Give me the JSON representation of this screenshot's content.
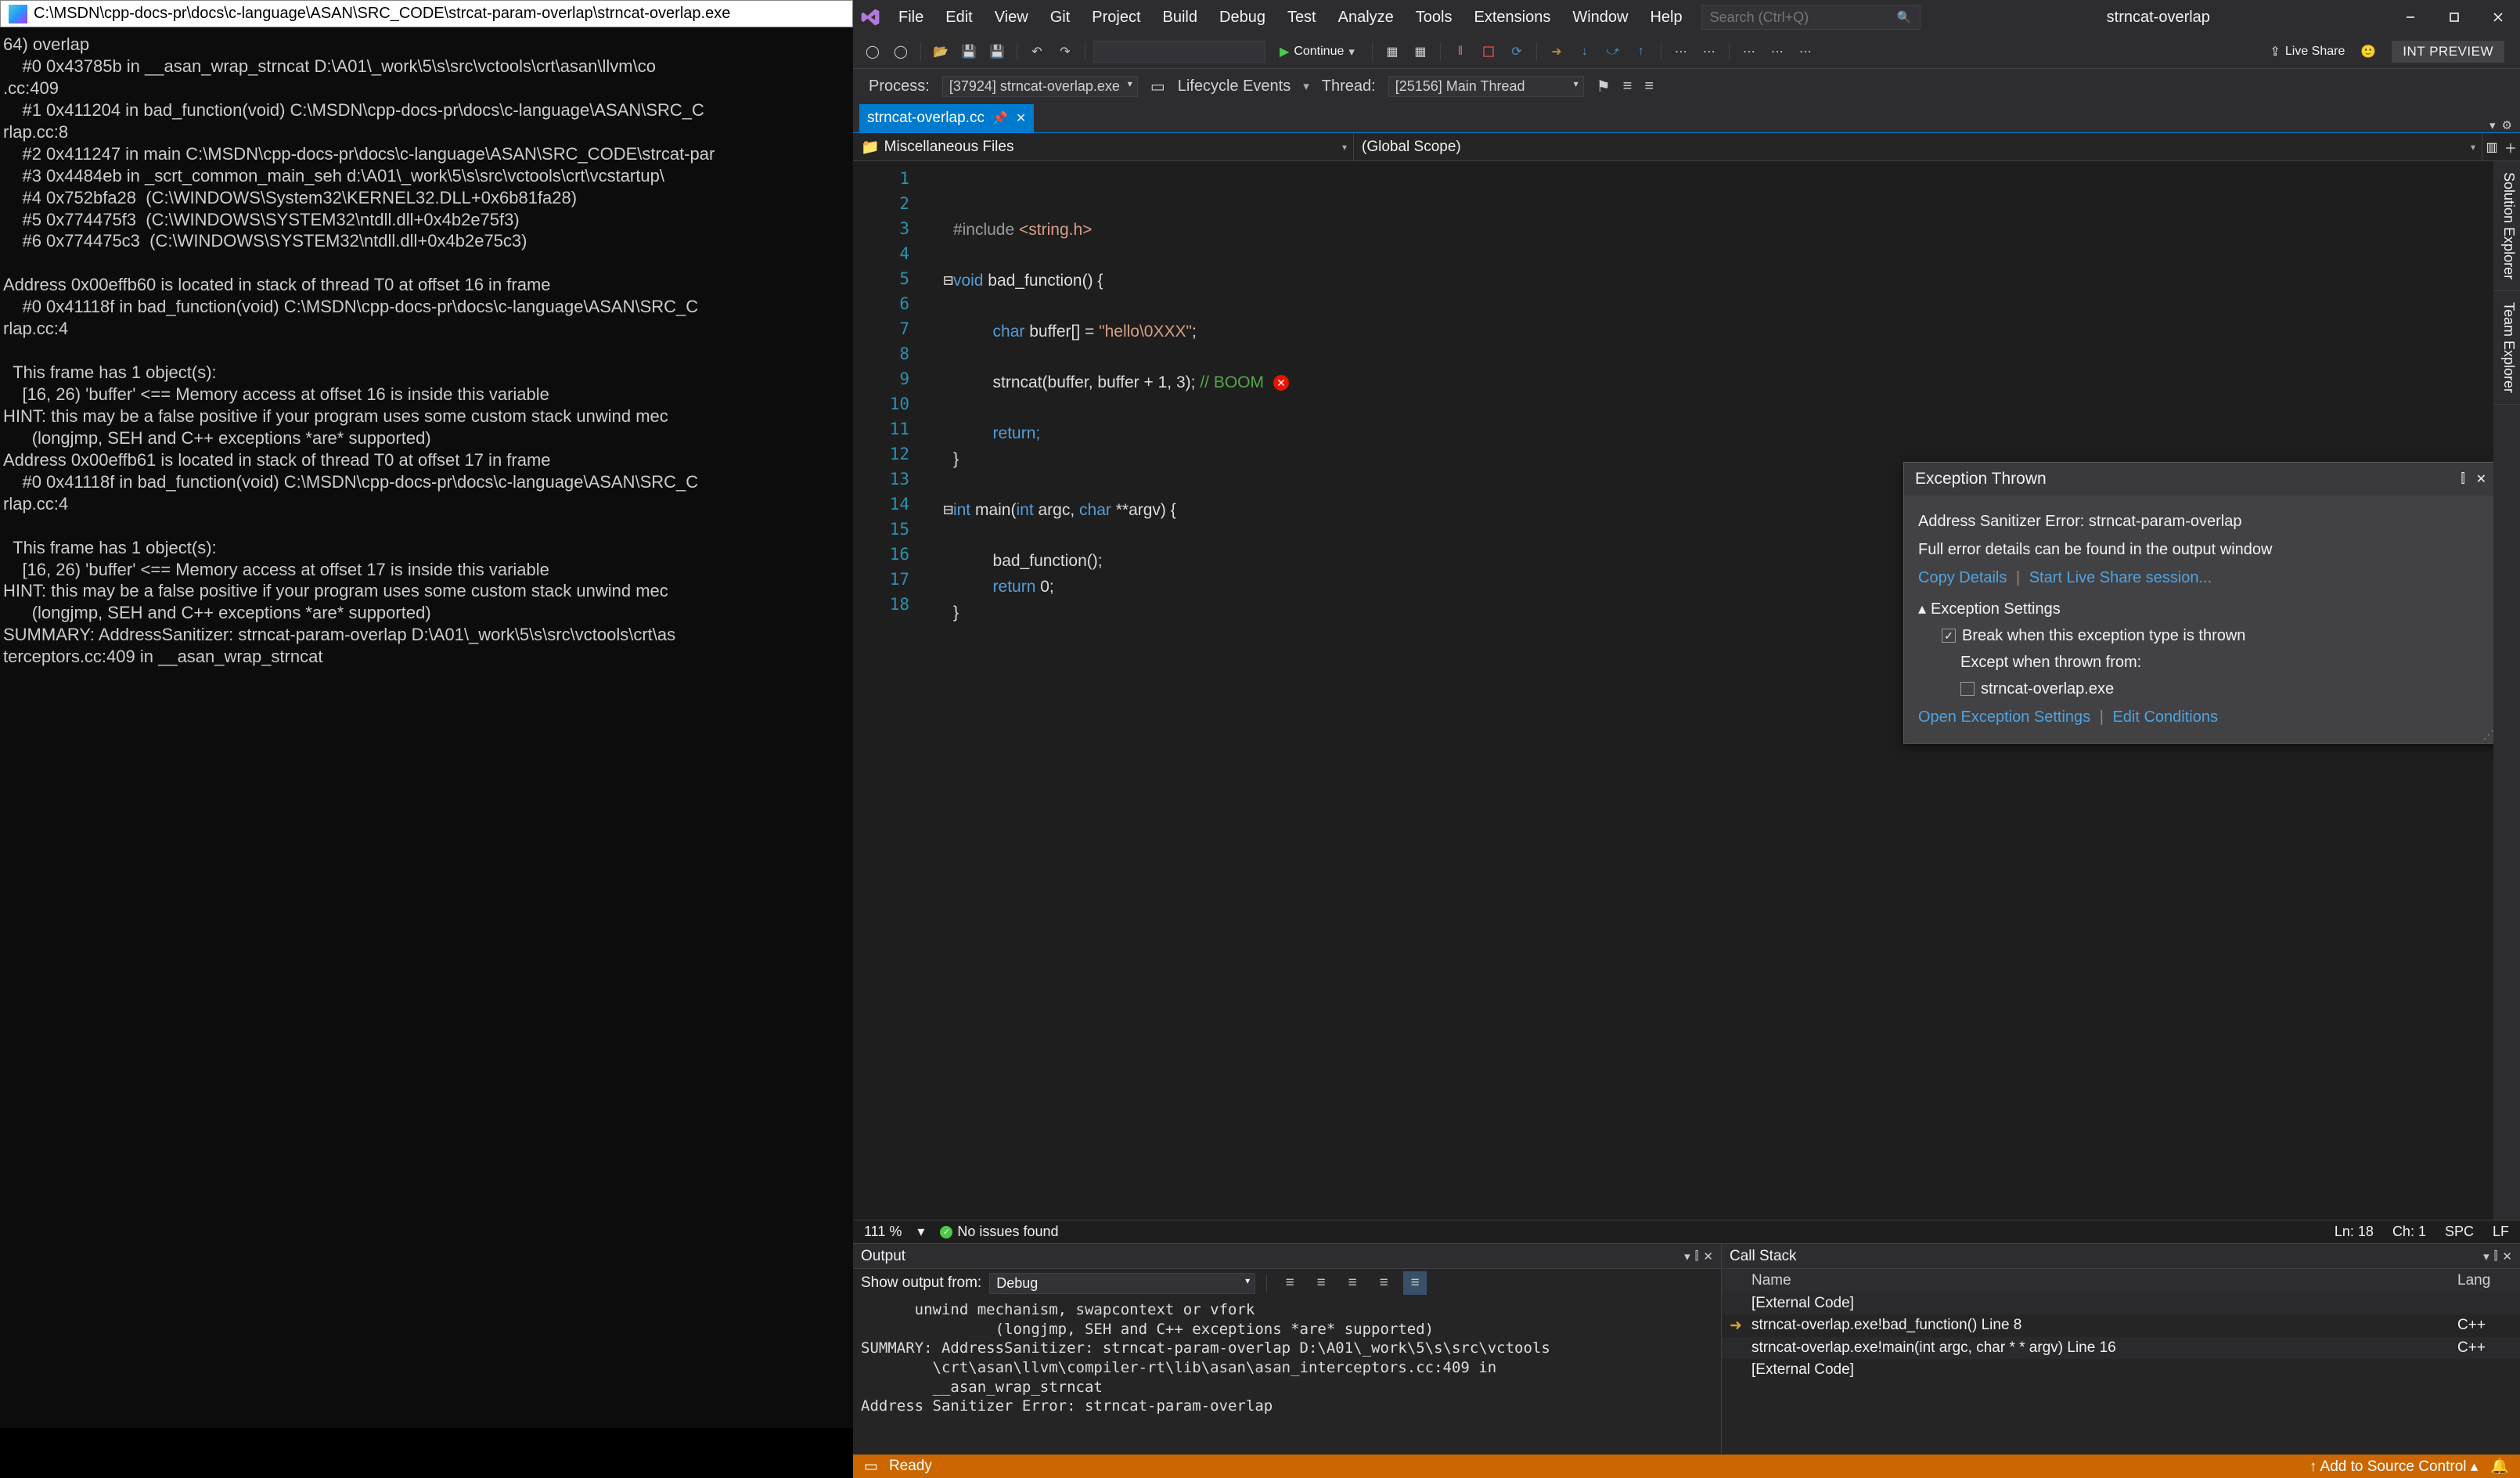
{
  "console": {
    "title": "C:\\MSDN\\cpp-docs-pr\\docs\\c-language\\ASAN\\SRC_CODE\\strcat-param-overlap\\strncat-overlap.exe",
    "body": "64) overlap\n    #0 0x43785b in __asan_wrap_strncat D:\\A01\\_work\\5\\s\\src\\vctools\\crt\\asan\\llvm\\co\n.cc:409\n    #1 0x411204 in bad_function(void) C:\\MSDN\\cpp-docs-pr\\docs\\c-language\\ASAN\\SRC_C\nrlap.cc:8\n    #2 0x411247 in main C:\\MSDN\\cpp-docs-pr\\docs\\c-language\\ASAN\\SRC_CODE\\strcat-par\n    #3 0x4484eb in _scrt_common_main_seh d:\\A01\\_work\\5\\s\\src\\vctools\\crt\\vcstartup\\\n    #4 0x752bfa28  (C:\\WINDOWS\\System32\\KERNEL32.DLL+0x6b81fa28)\n    #5 0x774475f3  (C:\\WINDOWS\\SYSTEM32\\ntdll.dll+0x4b2e75f3)\n    #6 0x774475c3  (C:\\WINDOWS\\SYSTEM32\\ntdll.dll+0x4b2e75c3)\n\nAddress 0x00effb60 is located in stack of thread T0 at offset 16 in frame\n    #0 0x41118f in bad_function(void) C:\\MSDN\\cpp-docs-pr\\docs\\c-language\\ASAN\\SRC_C\nrlap.cc:4\n\n  This frame has 1 object(s):\n    [16, 26) 'buffer' <== Memory access at offset 16 is inside this variable\nHINT: this may be a false positive if your program uses some custom stack unwind mec\n      (longjmp, SEH and C++ exceptions *are* supported)\nAddress 0x00effb61 is located in stack of thread T0 at offset 17 in frame\n    #0 0x41118f in bad_function(void) C:\\MSDN\\cpp-docs-pr\\docs\\c-language\\ASAN\\SRC_C\nrlap.cc:4\n\n  This frame has 1 object(s):\n    [16, 26) 'buffer' <== Memory access at offset 17 is inside this variable\nHINT: this may be a false positive if your program uses some custom stack unwind mec\n      (longjmp, SEH and C++ exceptions *are* supported)\nSUMMARY: AddressSanitizer: strncat-param-overlap D:\\A01\\_work\\5\\s\\src\\vctools\\crt\\as\nterceptors.cc:409 in __asan_wrap_strncat"
  },
  "menus": [
    "File",
    "Edit",
    "View",
    "Git",
    "Project",
    "Build",
    "Debug",
    "Test",
    "Analyze",
    "Tools",
    "Extensions",
    "Window",
    "Help"
  ],
  "search_placeholder": "Search (Ctrl+Q)",
  "solution_name": "strncat-overlap",
  "continue_label": "Continue",
  "live_share": "Live Share",
  "int_preview": "INT PREVIEW",
  "process_label": "Process:",
  "process_value": "[37924] strncat-overlap.exe",
  "lifecycle_label": "Lifecycle Events",
  "thread_label": "Thread:",
  "thread_value": "[25156] Main Thread",
  "tab_name": "strncat-overlap.cc",
  "nav1": "Miscellaneous Files",
  "nav2": "(Global Scope)",
  "code_lines": {
    "l1": "",
    "l2_a": "#include",
    "l2_b": " <string.h>",
    "l4_a": "void",
    "l4_b": " bad_function() {",
    "l6_a": "char",
    "l6_b": " buffer[] = ",
    "l6_c": "\"hello\\0XXX\"",
    "l6_d": ";",
    "l8_a": "strncat(buffer, buffer + 1, 3); ",
    "l8_b": "// BOOM",
    "l10": "return;",
    "l11": "}",
    "l13_a": "int",
    "l13_b": " main(",
    "l13_c": "int",
    "l13_d": " argc, ",
    "l13_e": "char",
    "l13_f": " **argv) {",
    "l15": "bad_function();",
    "l16_a": "return",
    "l16_b": " 0;",
    "l17": "}"
  },
  "side_tabs": [
    "Solution Explorer",
    "Team Explorer"
  ],
  "exception": {
    "title": "Exception Thrown",
    "error": "Address Sanitizer Error: strncat-param-overlap",
    "detail": "Full error details can be found in the output window",
    "copy": "Copy Details",
    "start_share": "Start Live Share session...",
    "settings_title": "Exception Settings",
    "check1": "Break when this exception type is thrown",
    "except_from": "Except when thrown from:",
    "check2": "strncat-overlap.exe",
    "open_settings": "Open Exception Settings",
    "edit_cond": "Edit Conditions"
  },
  "editor_status": {
    "zoom": "111 %",
    "issues": "No issues found",
    "ln": "Ln: 18",
    "ch": "Ch: 1",
    "spc": "SPC",
    "lf": "LF"
  },
  "output": {
    "title": "Output",
    "show_from_label": "Show output from:",
    "show_from_value": "Debug",
    "body": "      unwind mechanism, swapcontext or vfork\n               (longjmp, SEH and C++ exceptions *are* supported)\nSUMMARY: AddressSanitizer: strncat-param-overlap D:\\A01\\_work\\5\\s\\src\\vctools\n        \\crt\\asan\\llvm\\compiler-rt\\lib\\asan\\asan_interceptors.cc:409 in\n        __asan_wrap_strncat\nAddress Sanitizer Error: strncat-param-overlap"
  },
  "callstack": {
    "title": "Call Stack",
    "col_name": "Name",
    "col_lang": "Lang",
    "rows": [
      {
        "name": "[External Code]",
        "lang": ""
      },
      {
        "name": "strncat-overlap.exe!bad_function() Line 8",
        "lang": "C++"
      },
      {
        "name": "strncat-overlap.exe!main(int argc, char * * argv) Line 16",
        "lang": "C++"
      },
      {
        "name": "[External Code]",
        "lang": ""
      }
    ]
  },
  "vs_status": {
    "ready": "Ready",
    "source_control": "Add to Source Control"
  }
}
